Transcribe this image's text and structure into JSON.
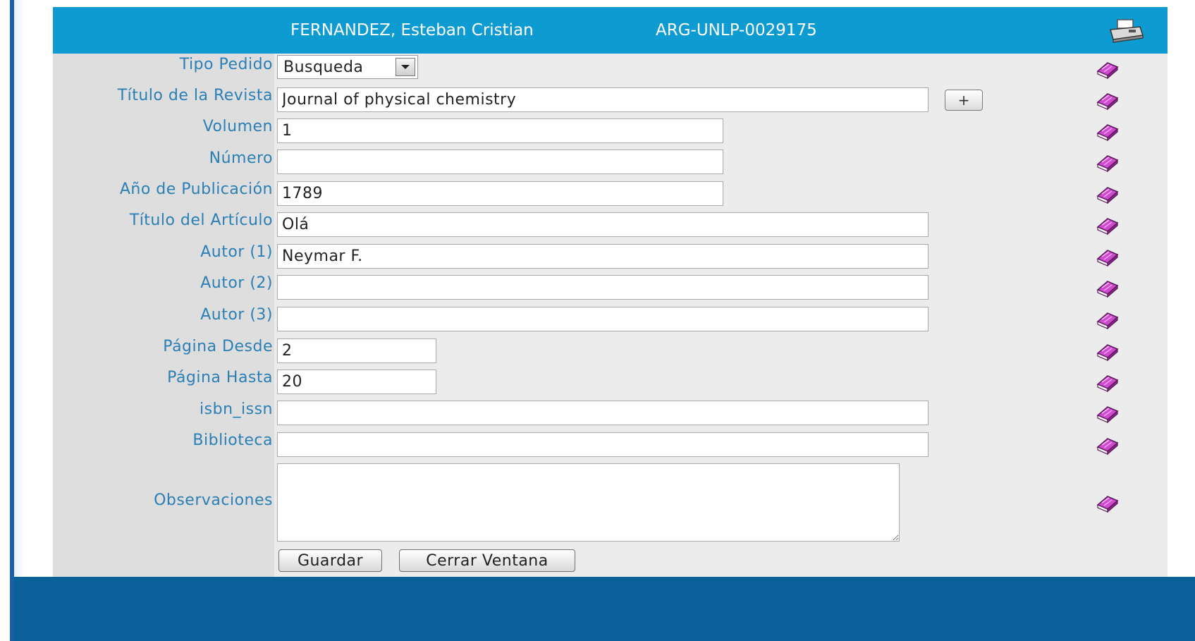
{
  "header": {
    "user_name": "FERNANDEZ, Esteban Cristian",
    "request_code": "ARG-UNLP-0029175",
    "print_icon": "printer-icon"
  },
  "form": {
    "tipo_pedido": {
      "label": "Tipo Pedido",
      "value": "Busqueda"
    },
    "titulo_revista": {
      "label": "Título de la Revista",
      "value": "Journal of physical chemistry",
      "add_label": "+"
    },
    "volumen": {
      "label": "Volumen",
      "value": "1"
    },
    "numero": {
      "label": "Número",
      "value": ""
    },
    "anio": {
      "label": "Año de Publicación",
      "value": "1789"
    },
    "titulo_articulo": {
      "label": "Título del Artículo",
      "value": "Olá"
    },
    "autor1": {
      "label": "Autor (1)",
      "value": "Neymar F."
    },
    "autor2": {
      "label": "Autor (2)",
      "value": ""
    },
    "autor3": {
      "label": "Autor (3)",
      "value": ""
    },
    "pagina_desde": {
      "label": "Página Desde",
      "value": "2"
    },
    "pagina_hasta": {
      "label": "Página Hasta",
      "value": "20"
    },
    "isbn_issn": {
      "label": "isbn_issn",
      "value": ""
    },
    "biblioteca": {
      "label": "Biblioteca",
      "value": ""
    },
    "observaciones": {
      "label": "Observaciones",
      "value": ""
    }
  },
  "actions": {
    "save_label": "Guardar",
    "close_label": "Cerrar Ventana"
  },
  "icons": {
    "row_icon": "book-icon"
  },
  "colors": {
    "header_bg": "#0d9bd2",
    "label_text": "#2a7fb5",
    "footer_bg": "#0a6099",
    "book_purple": "#b02fb0"
  }
}
